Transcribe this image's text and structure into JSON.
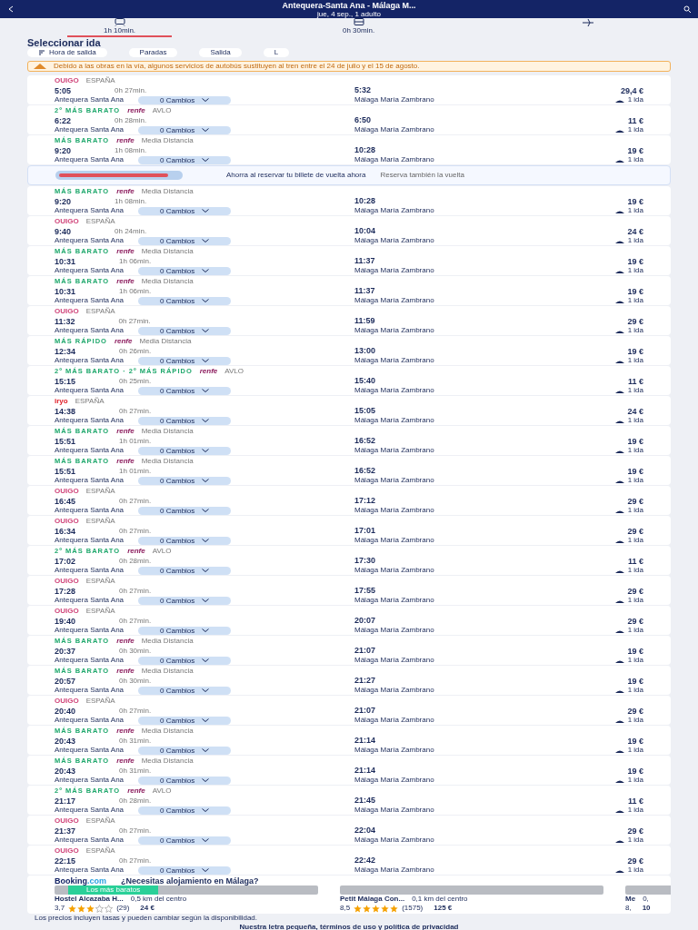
{
  "header": {
    "title": "Antequera-Santa Ana - Málaga M...",
    "subtitle": "jue, 4 sep., 1 adulto"
  },
  "modes": [
    {
      "kind": "train",
      "label": "1h 10min.",
      "selected": true
    },
    {
      "kind": "bus",
      "label": "0h 30min.",
      "selected": false
    },
    {
      "kind": "plane",
      "selected": false
    }
  ],
  "heading": "Seleccionar ida",
  "filters": [
    {
      "kind": "sort",
      "label": "Hora de salida"
    },
    {
      "kind": "chip",
      "label": "Paradas"
    },
    {
      "kind": "chip",
      "label": "Salida"
    },
    {
      "kind": "chip",
      "label": "L"
    }
  ],
  "notice": "Debido a las obras en la vía, algunos servicios de autobús sustituyen al tren entre el 24 de julio y el 15 de agosto.",
  "results": [
    {
      "kind": "ouigo",
      "brand": "OUIGO",
      "sub": "ESPAÑA",
      "depart": "5:05",
      "duration": "0h 27min.",
      "origin": "Antequera Santa Ana",
      "arrive": "5:32",
      "destination": "Málaga María Zambrano",
      "changes": "0 Cambios",
      "price": "29,4 €",
      "fare": "1 ida"
    },
    {
      "kind": "renfe",
      "tag": "2º MÁS BARATO",
      "brand": "renfe",
      "sub": "AVLO",
      "depart": "6:22",
      "duration": "0h 28min.",
      "origin": "Antequera Santa Ana",
      "arrive": "6:50",
      "destination": "Málaga María Zambrano",
      "changes": "0 Cambios",
      "price": "11 €",
      "fare": "1 ida"
    },
    {
      "kind": "renfe",
      "tag": "MÁS BARATO",
      "brand": "renfe",
      "sub": "Media Distancia",
      "depart": "9:20",
      "duration": "1h 08min.",
      "origin": "Antequera Santa Ana",
      "arrive": "10:28",
      "destination": "Málaga María Zambrano",
      "changes": "0 Cambios",
      "price": "19 €",
      "fare": "1 ida"
    },
    {
      "kind": "promo",
      "title": "Ahorra al reservar tu billete de vuelta ahora",
      "subtitle": "Reserva también la vuelta"
    },
    {
      "kind": "renfe",
      "tag": "MÁS BARATO",
      "brand": "renfe",
      "sub": "Media Distancia",
      "depart": "9:20",
      "duration": "1h 08min.",
      "origin": "Antequera Santa Ana",
      "arrive": "10:28",
      "destination": "Málaga María Zambrano",
      "changes": "0 Cambios",
      "price": "19 €",
      "fare": "1 ida"
    },
    {
      "kind": "ouigo",
      "brand": "OUIGO",
      "sub": "ESPAÑA",
      "depart": "9:40",
      "duration": "0h 24min.",
      "origin": "Antequera Santa Ana",
      "arrive": "10:04",
      "destination": "Málaga María Zambrano",
      "changes": "0 Cambios",
      "price": "24 €",
      "fare": "1 ida"
    },
    {
      "kind": "renfe",
      "tag": "MÁS BARATO",
      "brand": "renfe",
      "sub": "Media Distancia",
      "depart": "10:31",
      "duration": "1h 06min.",
      "origin": "Antequera Santa Ana",
      "arrive": "11:37",
      "destination": "Málaga María Zambrano",
      "changes": "0 Cambios",
      "price": "19 €",
      "fare": "1 ida"
    },
    {
      "kind": "renfe",
      "tag": "MÁS BARATO",
      "brand": "renfe",
      "sub": "Media Distancia",
      "depart": "10:31",
      "duration": "1h 06min.",
      "origin": "Antequera Santa Ana",
      "arrive": "11:37",
      "destination": "Málaga María Zambrano",
      "changes": "0 Cambios",
      "price": "19 €",
      "fare": "1 ida"
    },
    {
      "kind": "ouigo",
      "brand": "OUIGO",
      "sub": "ESPAÑA",
      "depart": "11:32",
      "duration": "0h 27min.",
      "origin": "Antequera Santa Ana",
      "arrive": "11:59",
      "destination": "Málaga María Zambrano",
      "changes": "0 Cambios",
      "price": "29 €",
      "fare": "1 ida"
    },
    {
      "kind": "renfe",
      "tag": "MÁS RÁPIDO",
      "brand": "renfe",
      "sub": "Media Distancia",
      "depart": "12:34",
      "duration": "0h 26min.",
      "origin": "Antequera Santa Ana",
      "arrive": "13:00",
      "destination": "Málaga María Zambrano",
      "changes": "0 Cambios",
      "price": "19 €",
      "fare": "1 ida"
    },
    {
      "kind": "renfe",
      "tag": "2º MÁS BARATO · 2º MÁS RÁPIDO",
      "brand": "renfe",
      "sub": "AVLO",
      "depart": "15:15",
      "duration": "0h 25min.",
      "origin": "Antequera Santa Ana",
      "arrive": "15:40",
      "destination": "Málaga María Zambrano",
      "changes": "0 Cambios",
      "price": "11 €",
      "fare": "1 ida"
    },
    {
      "kind": "iryo",
      "brand": "iryo",
      "sub": "ESPAÑA",
      "depart": "14:38",
      "duration": "0h 27min.",
      "origin": "Antequera Santa Ana",
      "arrive": "15:05",
      "destination": "Málaga María Zambrano",
      "changes": "0 Cambios",
      "price": "24 €",
      "fare": "1 ida"
    },
    {
      "kind": "renfe",
      "tag": "MÁS BARATO",
      "brand": "renfe",
      "sub": "Media Distancia",
      "depart": "15:51",
      "duration": "1h 01min.",
      "origin": "Antequera Santa Ana",
      "arrive": "16:52",
      "destination": "Málaga María Zambrano",
      "changes": "0 Cambios",
      "price": "19 €",
      "fare": "1 ida"
    },
    {
      "kind": "renfe",
      "tag": "MÁS BARATO",
      "brand": "renfe",
      "sub": "Media Distancia",
      "depart": "15:51",
      "duration": "1h 01min.",
      "origin": "Antequera Santa Ana",
      "arrive": "16:52",
      "destination": "Málaga María Zambrano",
      "changes": "0 Cambios",
      "price": "19 €",
      "fare": "1 ida"
    },
    {
      "kind": "ouigo",
      "brand": "OUIGO",
      "sub": "ESPAÑA",
      "depart": "16:45",
      "duration": "0h 27min.",
      "origin": "Antequera Santa Ana",
      "arrive": "17:12",
      "destination": "Málaga María Zambrano",
      "changes": "0 Cambios",
      "price": "29 €",
      "fare": "1 ida"
    },
    {
      "kind": "ouigo",
      "brand": "OUIGO",
      "sub": "ESPAÑA",
      "depart": "16:34",
      "duration": "0h 27min.",
      "origin": "Antequera Santa Ana",
      "arrive": "17:01",
      "destination": "Málaga María Zambrano",
      "changes": "0 Cambios",
      "price": "29 €",
      "fare": "1 ida"
    },
    {
      "kind": "renfe",
      "tag": "2º MÁS BARATO",
      "brand": "renfe",
      "sub": "AVLO",
      "depart": "17:02",
      "duration": "0h 28min.",
      "origin": "Antequera Santa Ana",
      "arrive": "17:30",
      "destination": "Málaga María Zambrano",
      "changes": "0 Cambios",
      "price": "11 €",
      "fare": "1 ida"
    },
    {
      "kind": "ouigo",
      "brand": "OUIGO",
      "sub": "ESPAÑA",
      "depart": "17:28",
      "duration": "0h 27min.",
      "origin": "Antequera Santa Ana",
      "arrive": "17:55",
      "destination": "Málaga María Zambrano",
      "changes": "0 Cambios",
      "price": "29 €",
      "fare": "1 ida"
    },
    {
      "kind": "ouigo",
      "brand": "OUIGO",
      "sub": "ESPAÑA",
      "depart": "19:40",
      "duration": "0h 27min.",
      "origin": "Antequera Santa Ana",
      "arrive": "20:07",
      "destination": "Málaga María Zambrano",
      "changes": "0 Cambios",
      "price": "29 €",
      "fare": "1 ida"
    },
    {
      "kind": "renfe",
      "tag": "MÁS BARATO",
      "brand": "renfe",
      "sub": "Media Distancia",
      "depart": "20:37",
      "duration": "0h 30min.",
      "origin": "Antequera Santa Ana",
      "arrive": "21:07",
      "destination": "Málaga María Zambrano",
      "changes": "0 Cambios",
      "price": "19 €",
      "fare": "1 ida"
    },
    {
      "kind": "renfe",
      "tag": "MÁS BARATO",
      "brand": "renfe",
      "sub": "Media Distancia",
      "depart": "20:57",
      "duration": "0h 30min.",
      "origin": "Antequera Santa Ana",
      "arrive": "21:27",
      "destination": "Málaga María Zambrano",
      "changes": "0 Cambios",
      "price": "19 €",
      "fare": "1 ida"
    },
    {
      "kind": "ouigo",
      "brand": "OUIGO",
      "sub": "ESPAÑA",
      "depart": "20:40",
      "duration": "0h 27min.",
      "origin": "Antequera Santa Ana",
      "arrive": "21:07",
      "destination": "Málaga María Zambrano",
      "changes": "0 Cambios",
      "price": "29 €",
      "fare": "1 ida"
    },
    {
      "kind": "renfe",
      "tag": "MÁS BARATO",
      "brand": "renfe",
      "sub": "Media Distancia",
      "depart": "20:43",
      "duration": "0h 31min.",
      "origin": "Antequera Santa Ana",
      "arrive": "21:14",
      "destination": "Málaga María Zambrano",
      "changes": "0 Cambios",
      "price": "19 €",
      "fare": "1 ida"
    },
    {
      "kind": "renfe",
      "tag": "MÁS BARATO",
      "brand": "renfe",
      "sub": "Media Distancia",
      "depart": "20:43",
      "duration": "0h 31min.",
      "origin": "Antequera Santa Ana",
      "arrive": "21:14",
      "destination": "Málaga María Zambrano",
      "changes": "0 Cambios",
      "price": "19 €",
      "fare": "1 ida"
    },
    {
      "kind": "renfe",
      "tag": "2º MÁS BARATO",
      "brand": "renfe",
      "sub": "AVLO",
      "depart": "21:17",
      "duration": "0h 28min.",
      "origin": "Antequera Santa Ana",
      "arrive": "21:45",
      "destination": "Málaga María Zambrano",
      "changes": "0 Cambios",
      "price": "11 €",
      "fare": "1 ida"
    },
    {
      "kind": "ouigo",
      "brand": "OUIGO",
      "sub": "ESPAÑA",
      "depart": "21:37",
      "duration": "0h 27min.",
      "origin": "Antequera Santa Ana",
      "arrive": "22:04",
      "destination": "Málaga María Zambrano",
      "changes": "0 Cambios",
      "price": "29 €",
      "fare": "1 ida"
    },
    {
      "kind": "ouigo",
      "brand": "OUIGO",
      "sub": "ESPAÑA",
      "depart": "22:15",
      "duration": "0h 27min.",
      "origin": "Antequera Santa Ana",
      "arrive": "22:42",
      "destination": "Málaga María Zambrano",
      "changes": "0 Cambios",
      "price": "29 €",
      "fare": "1 ida"
    }
  ],
  "lodging": {
    "brand": "Booking",
    "brand_suffix": ".com",
    "title": "¿Necesitas alojamiento en Málaga?",
    "hotels": [
      {
        "badge": "Los más baratos",
        "name": "Hostel Alcazaba H...",
        "distance": "0,5 km del centro",
        "rating": "3,7",
        "stars": 3,
        "reviews": "(29)",
        "price": "24 €"
      },
      {
        "name": "Petit Málaga Con...",
        "distance": "0,1 km del centro",
        "rating": "8,5",
        "stars": 5,
        "reviews": "(1575)",
        "price": "125 €"
      },
      {
        "name": "Me",
        "distance": "0,",
        "rating": "8,",
        "price": "10"
      }
    ]
  },
  "footer": {
    "note": "Los precios incluyen tasas y pueden cambiar según la disponibilidad.",
    "link": "Nuestra letra pequeña, términos de uso y política de privacidad"
  }
}
